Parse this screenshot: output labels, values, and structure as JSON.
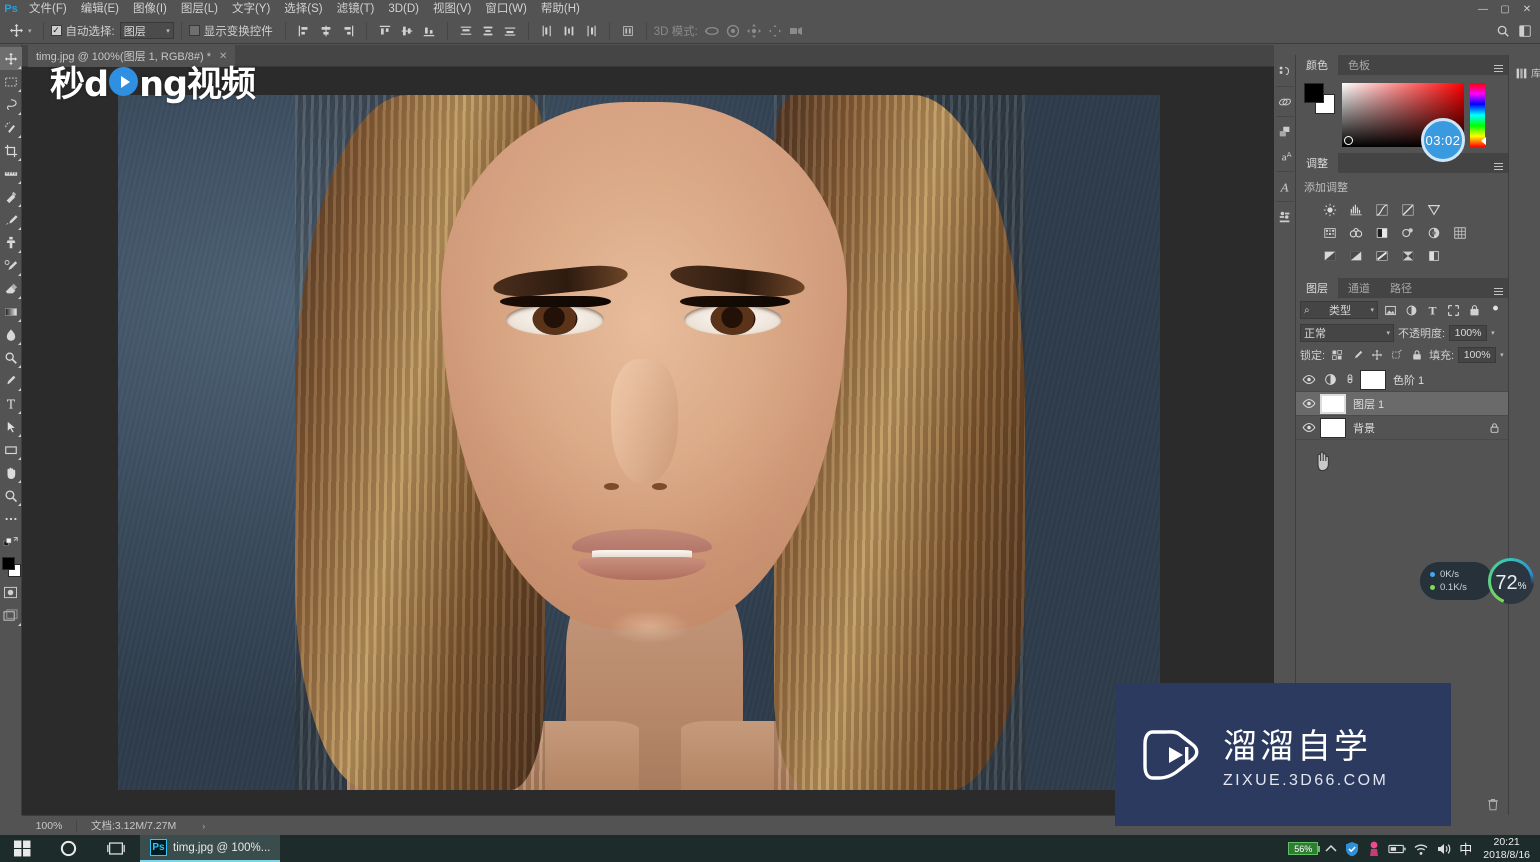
{
  "app": {
    "name": "Ps",
    "logo_color": "#2a9fd8"
  },
  "menubar": {
    "items": [
      {
        "label": "文件(F)",
        "name": "menu-file"
      },
      {
        "label": "编辑(E)",
        "name": "menu-edit"
      },
      {
        "label": "图像(I)",
        "name": "menu-image"
      },
      {
        "label": "图层(L)",
        "name": "menu-layer"
      },
      {
        "label": "文字(Y)",
        "name": "menu-type"
      },
      {
        "label": "选择(S)",
        "name": "menu-select"
      },
      {
        "label": "滤镜(T)",
        "name": "menu-filter"
      },
      {
        "label": "3D(D)",
        "name": "menu-3d"
      },
      {
        "label": "视图(V)",
        "name": "menu-view"
      },
      {
        "label": "窗口(W)",
        "name": "menu-window"
      },
      {
        "label": "帮助(H)",
        "name": "menu-help"
      }
    ],
    "window_buttons": {
      "minimize": "—",
      "maximize": "▢",
      "close": "✕"
    }
  },
  "options_bar": {
    "auto_select_checked": true,
    "auto_select_label": "自动选择:",
    "auto_select_value": "图层",
    "show_transform_label": "显示变换控件",
    "show_transform_checked": false,
    "mode_3d_label": "3D 模式:",
    "check_glyph": "✓"
  },
  "document_tab": {
    "title": "timg.jpg @ 100%(图层 1, RGB/8#) *",
    "short": "timg.j",
    "suffix": "RGB/8#) *",
    "close_glyph": "✕"
  },
  "color_panel": {
    "tabs": [
      {
        "label": "颜色"
      },
      {
        "label": "色板"
      }
    ],
    "active_tab": "颜色",
    "foreground": "#000000",
    "background": "#ffffff"
  },
  "adjustments_panel": {
    "tab": "调整",
    "add_label": "添加调整"
  },
  "layers_panel": {
    "tabs": [
      {
        "label": "图层"
      },
      {
        "label": "通道"
      },
      {
        "label": "路径"
      }
    ],
    "active_tab": "图层",
    "filter_kind": "类型",
    "blend_mode": "正常",
    "opacity_label": "不透明度:",
    "opacity_value": "100%",
    "lock_label": "锁定:",
    "fill_label": "填充:",
    "fill_value": "100%",
    "layers": [
      {
        "name": "色阶 1",
        "type": "adjustment",
        "visible": true,
        "selected": false,
        "locked": false,
        "has_mask": true
      },
      {
        "name": "图层 1",
        "type": "pixel",
        "visible": true,
        "selected": true,
        "locked": false,
        "has_mask": false
      },
      {
        "name": "背景",
        "type": "pixel",
        "visible": true,
        "selected": false,
        "locked": true,
        "has_mask": false
      }
    ]
  },
  "status_bar": {
    "zoom": "100%",
    "doc_info": "文档:3.12M/7.27M",
    "arrow": "›"
  },
  "overlays": {
    "top_watermark": {
      "part1": "秒d",
      "part2": "ng视频"
    },
    "timer_badge": "03:02",
    "network": {
      "upload": "0K/s",
      "download": "0.1K/s",
      "gauge_value": "72",
      "gauge_unit": "%"
    },
    "bottom_watermark": {
      "title": "溜溜自学",
      "url": "ZIXUE.3D66.COM"
    }
  },
  "taskbar": {
    "app_label": "timg.jpg @ 100%...",
    "app_icon": "Ps",
    "battery": "56%",
    "ime": "中",
    "clock_time": "20:21",
    "clock_date": "2018/8/16"
  },
  "right_edge": {
    "label": "库"
  }
}
